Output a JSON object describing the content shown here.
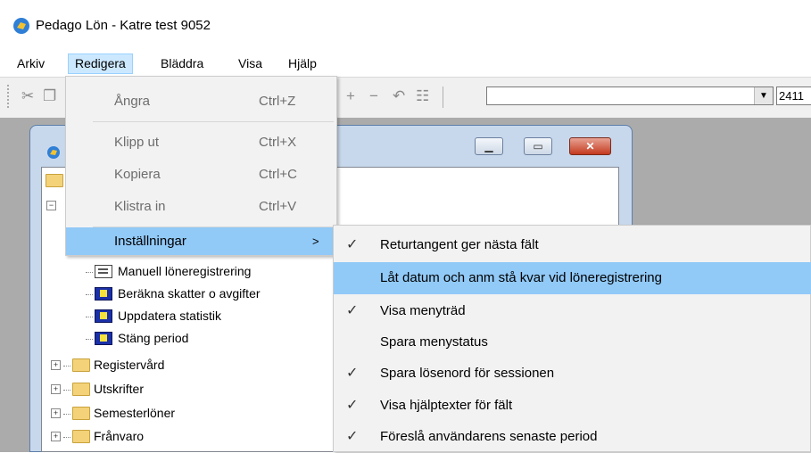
{
  "window": {
    "title": "Pedago Lön - Katre test 9052"
  },
  "menubar": [
    {
      "label": "Arkiv"
    },
    {
      "label": "Redigera"
    },
    {
      "label": "Bläddra"
    },
    {
      "label": "Visa"
    },
    {
      "label": "Hjälp"
    }
  ],
  "toolbar": {
    "icons": [
      "cut-icon",
      "copy-icon",
      "add-icon",
      "remove-icon",
      "undo-icon",
      "list-icon"
    ],
    "field_value": "2411",
    "combo_value": ""
  },
  "edit_menu": {
    "items": [
      {
        "label": "Ångra",
        "shortcut": "Ctrl+Z",
        "enabled": false
      },
      {
        "label": "Klipp ut",
        "shortcut": "Ctrl+X",
        "enabled": false
      },
      {
        "label": "Kopiera",
        "shortcut": "Ctrl+C",
        "enabled": false
      },
      {
        "label": "Klistra in",
        "shortcut": "Ctrl+V",
        "enabled": false
      },
      {
        "label": "Inställningar",
        "shortcut": "",
        "enabled": true,
        "has_submenu": true,
        "highlighted": true
      }
    ]
  },
  "settings_submenu": {
    "items": [
      {
        "label": "Returtangent ger nästa fält",
        "checked": true
      },
      {
        "label": "Låt datum och anm stå kvar vid löneregistrering",
        "checked": false,
        "highlighted": true
      },
      {
        "label": "Visa menyträd",
        "checked": true
      },
      {
        "label": "Spara menystatus",
        "checked": false
      },
      {
        "label": "Spara lösenord för sessionen",
        "checked": true
      },
      {
        "label": "Visa hjälptexter för fält",
        "checked": true
      },
      {
        "label": "Föreslå användarens senaste period",
        "checked": true
      }
    ]
  },
  "tree": {
    "items": [
      {
        "label": "Manuell löneregistrering",
        "icon": "document-icon"
      },
      {
        "label": "Beräkna skatter o avgifter",
        "icon": "run-icon"
      },
      {
        "label": "Uppdatera statistik",
        "icon": "run-icon"
      },
      {
        "label": "Stäng period",
        "icon": "run-icon"
      },
      {
        "label": "Registervård",
        "icon": "folder-icon"
      },
      {
        "label": "Utskrifter",
        "icon": "folder-icon"
      },
      {
        "label": "Semesterlöner",
        "icon": "folder-icon"
      },
      {
        "label": "Frånvaro",
        "icon": "folder-icon"
      }
    ]
  },
  "colors": {
    "highlight": "#91c9f7",
    "menu_bg": "#f2f2f2",
    "mdi_bg": "#ababab",
    "menubar_active": "#cce8ff"
  }
}
